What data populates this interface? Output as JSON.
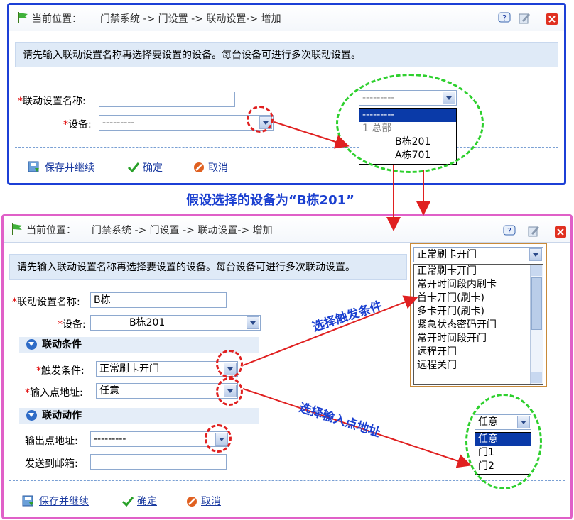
{
  "breadcrumb": {
    "label": "当前位置：",
    "path": "门禁系统 -> 门设置 -> 联动设置-> 增加"
  },
  "notice": "请先输入联动设置名称再选择要设置的设备。每台设备可进行多次联动设置。",
  "form1": {
    "name_label": "*联动设置名称:",
    "name_value": "",
    "device_label": "*设备:",
    "device_value": "---------"
  },
  "dropdown1": {
    "selected": "---------",
    "items": [
      "---------",
      "1 总部",
      "B栋201",
      "A栋701"
    ]
  },
  "buttons": {
    "save_continue": "保存并继续",
    "ok": "确定",
    "cancel": "取消"
  },
  "annotation_device": "假设选择的设备为“B栋201”",
  "form2": {
    "name_label": "*联动设置名称:",
    "name_value": "B栋",
    "device_label": "*设备:",
    "device_value": "B栋201",
    "section_condition": "联动条件",
    "trigger_label": "*触发条件:",
    "trigger_value": "正常刷卡开门",
    "input_label": "*输入点地址:",
    "input_value": "任意",
    "section_action": "联动动作",
    "output_label": "输出点地址:",
    "output_value": "---------",
    "email_label": "发送到邮箱:",
    "email_value": ""
  },
  "dropdown_trigger": {
    "selected": "正常刷卡开门",
    "items": [
      "正常刷卡开门",
      "常开时间段内刷卡",
      "首卡开门(刷卡)",
      "多卡开门(刷卡)",
      "紧急状态密码开门",
      "常开时间段开门",
      "远程开门",
      "远程关门"
    ]
  },
  "annotation_trigger": "选择触发条件",
  "annotation_input": "选择输入点地址",
  "dropdown_input": {
    "selected": "任意",
    "items": [
      "任意",
      "门1",
      "门2"
    ]
  },
  "colors": {
    "panel1_border": "#1c3fd6",
    "panel2_border": "#e060c8",
    "highlight": "#0a3aa8",
    "arrow": "#e02020",
    "green_circle": "#2ed02e"
  }
}
